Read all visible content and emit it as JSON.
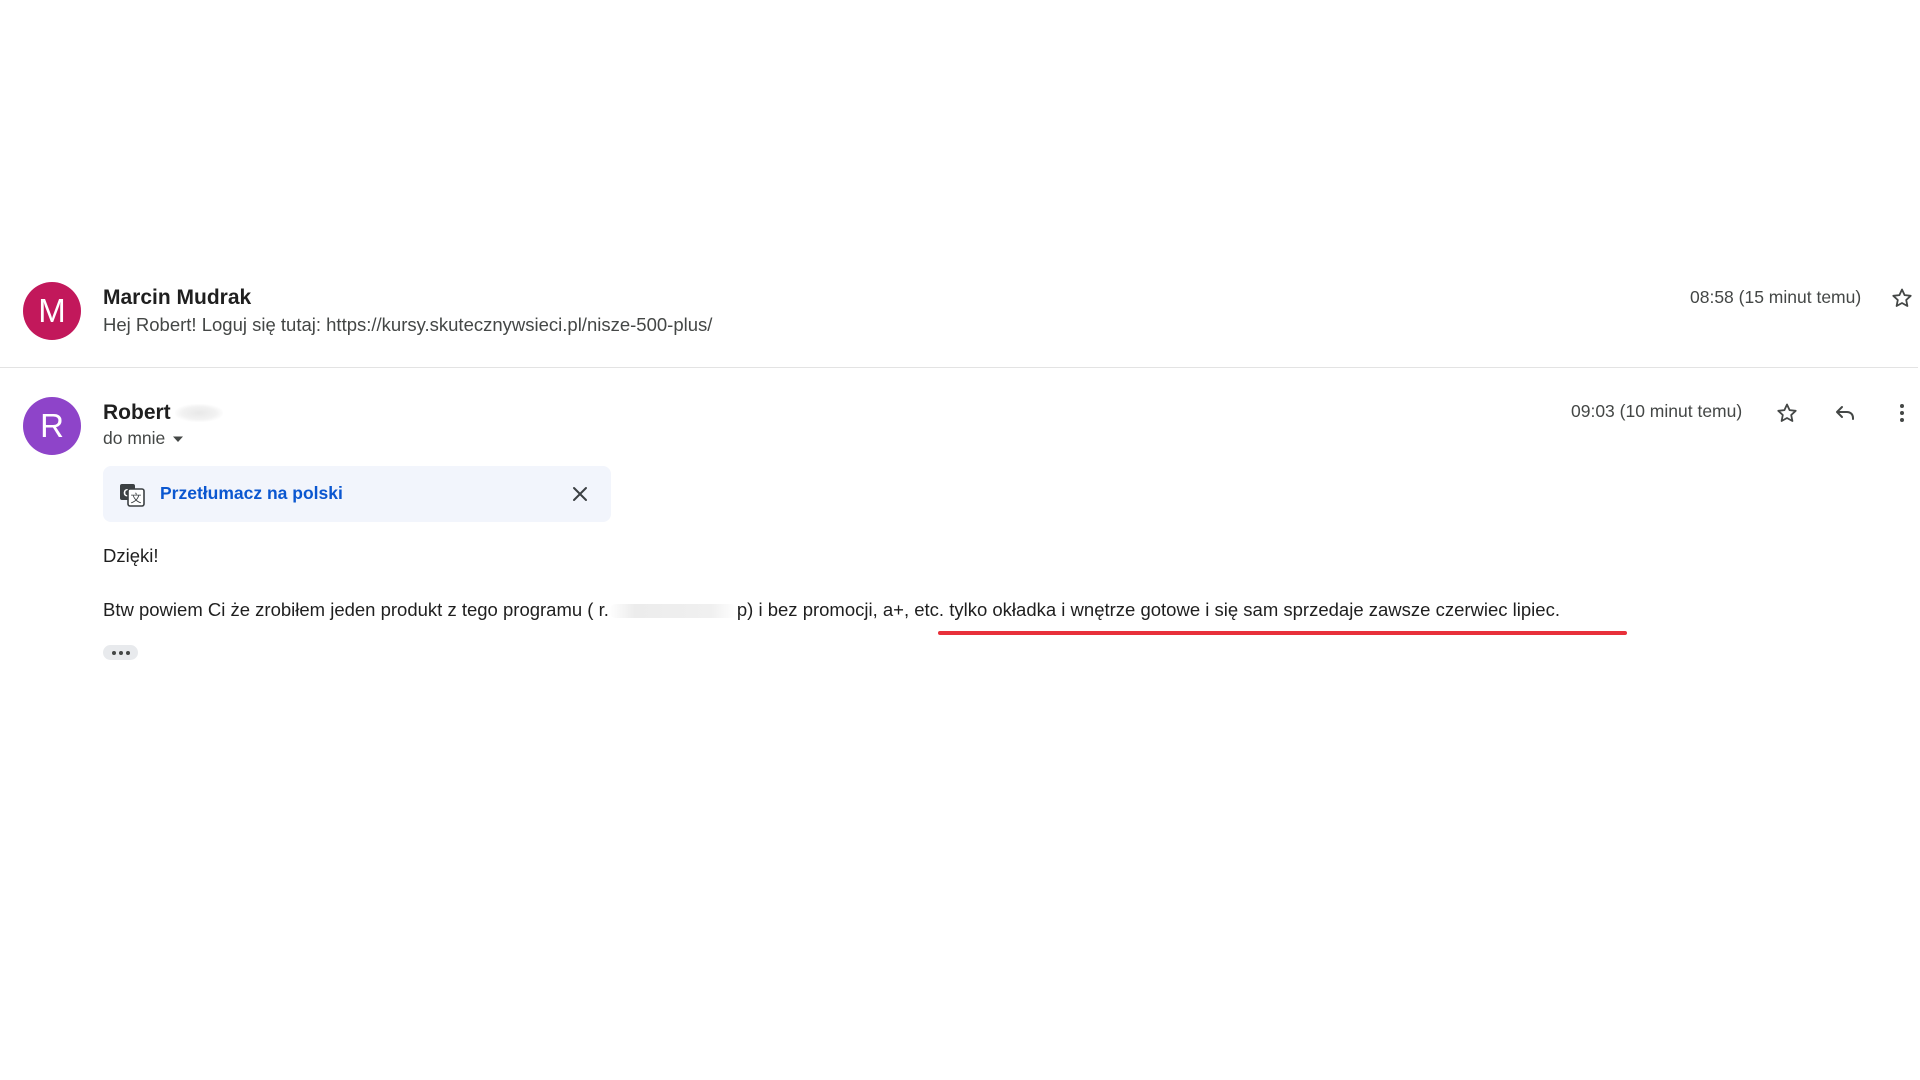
{
  "colors": {
    "avatar_marcin": "#c2185b",
    "avatar_robert": "#8e44c9",
    "link": "#0b57d0",
    "underline": "#e8303a"
  },
  "message1": {
    "avatar_letter": "M",
    "sender": "Marcin Mudrak",
    "snippet": "Hej Robert! Loguj się tutaj: https://kursy.skutecznywsieci.pl/nisze-500-plus/",
    "timestamp": "08:58 (15 minut temu)",
    "icons": [
      "star-icon"
    ]
  },
  "message2": {
    "avatar_letter": "R",
    "sender": "Robert",
    "recipient": "do mnie",
    "timestamp": "09:03 (10 minut temu)",
    "icons": [
      "star-icon",
      "reply-icon",
      "more-vert-icon"
    ],
    "translate": {
      "label": "Przetłumacz na polski",
      "icon": "translate-icon",
      "close_icon": "close-icon"
    },
    "body": {
      "greeting": "Dzięki!",
      "line_part1": "Btw powiem Ci że zrobiłem jeden produkt z tego programu ( r.",
      "line_part2": "p) i bez promocji, a+, etc. tylko okładka i wnętrze gotowe i się sam sprzedaje zawsze czerwiec lipiec."
    },
    "more_button_icon": "ellipsis-icon"
  }
}
